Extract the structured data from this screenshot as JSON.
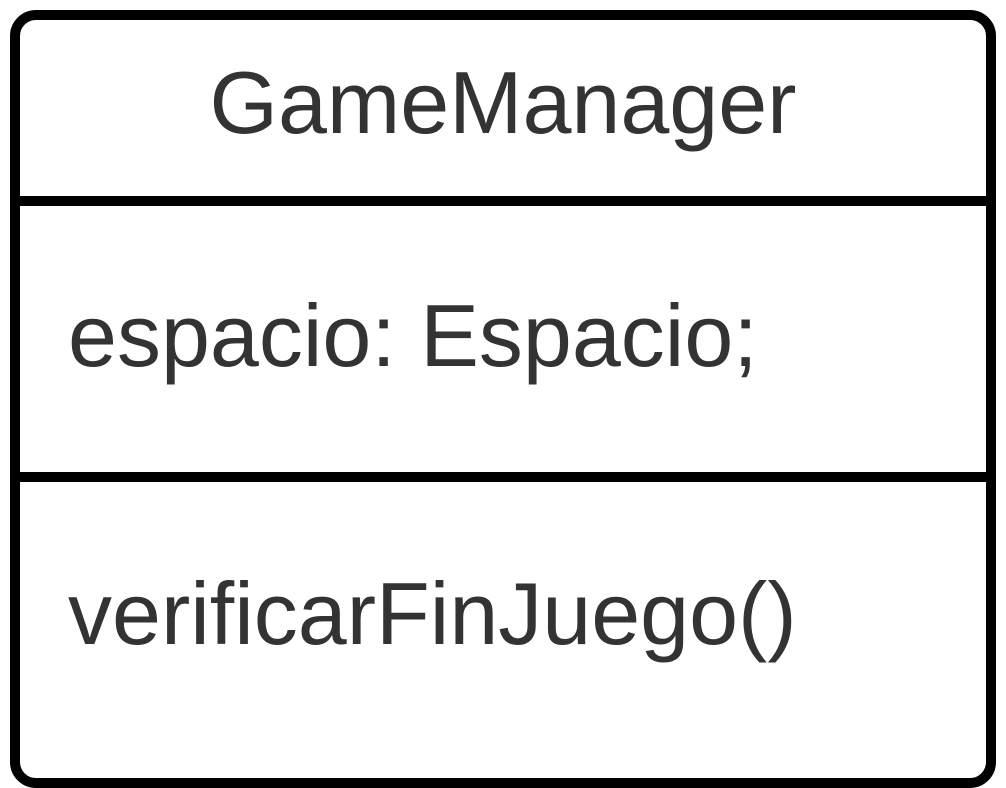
{
  "class": {
    "name": "GameManager",
    "attributes": [
      "espacio: Espacio;"
    ],
    "methods": [
      "verificarFinJuego()"
    ]
  },
  "colors": {
    "border": "#000000",
    "text": "#333333",
    "background": "#ffffff"
  }
}
